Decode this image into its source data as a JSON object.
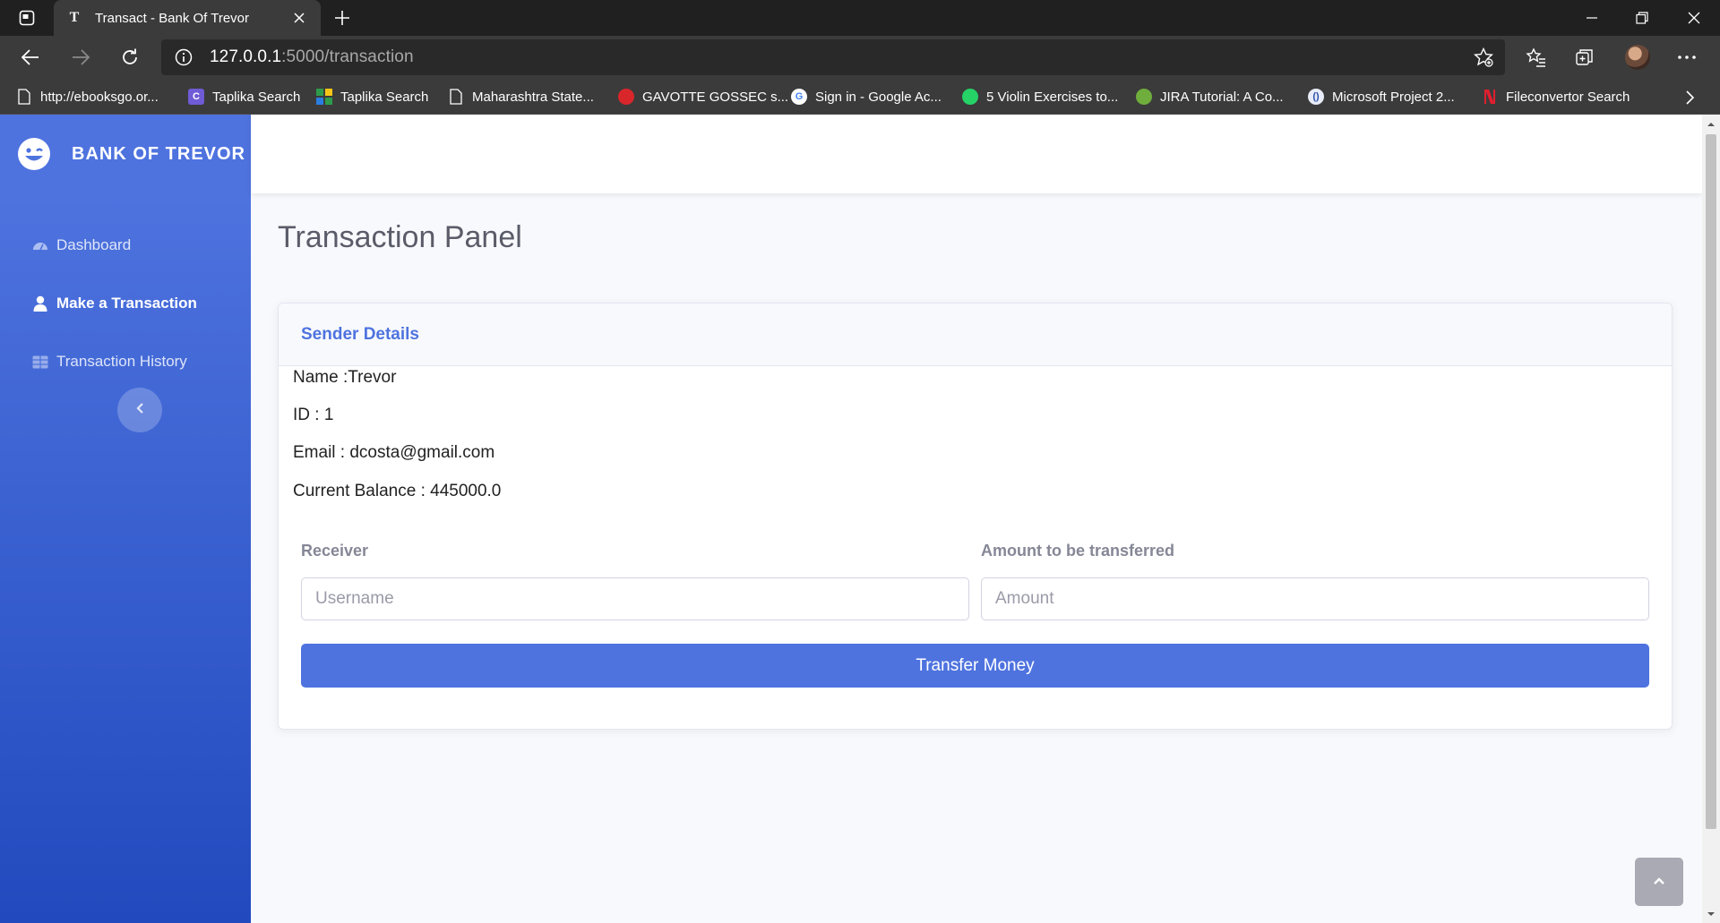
{
  "browser": {
    "tab_title": "Transact - Bank Of Trevor",
    "url_host": "127.0.0.1",
    "url_path": ":5000/transaction",
    "bookmarks": [
      {
        "label": "http://ebooksgo.or...",
        "icon": "page-icon"
      },
      {
        "label": "Taplika Search",
        "icon": "taplika-c-icon"
      },
      {
        "label": "Taplika Search",
        "icon": "taplika-grid-icon"
      },
      {
        "label": "Maharashtra State...",
        "icon": "page-icon"
      },
      {
        "label": "GAVOTTE GOSSEC s...",
        "icon": "red-circle-icon"
      },
      {
        "label": "Sign in - Google Ac...",
        "icon": "google-icon"
      },
      {
        "label": "5 Violin Exercises to...",
        "icon": "whatsapp-icon"
      },
      {
        "label": "JIRA Tutorial: A Co...",
        "icon": "green-circle-icon"
      },
      {
        "label": "Microsoft Project 2...",
        "icon": "blue-circle-icon"
      },
      {
        "label": "Fileconvertor Search",
        "icon": "red-bolt-icon"
      }
    ]
  },
  "sidebar": {
    "brand": "BANK OF TREVOR",
    "items": [
      {
        "label": "Dashboard",
        "icon": "tachometer-icon"
      },
      {
        "label": "Make a Transaction",
        "icon": "user-icon"
      },
      {
        "label": "Transaction History",
        "icon": "table-icon"
      }
    ]
  },
  "main": {
    "title": "Transaction Panel",
    "card": {
      "header": "Sender Details",
      "name": "Name :Trevor",
      "id": "ID : 1",
      "email": "Email : dcosta@gmail.com",
      "balance": "Current Balance : 445000.0"
    },
    "form": {
      "receiver_label": "Receiver",
      "receiver_placeholder": "Username",
      "amount_label": "Amount to be transferred",
      "amount_placeholder": "Amount",
      "submit_label": "Transfer Money"
    }
  },
  "colors": {
    "primary": "#4e73df",
    "sidebar_gradient_end": "#224abe",
    "heading": "#5a5c69",
    "label": "#858796"
  }
}
